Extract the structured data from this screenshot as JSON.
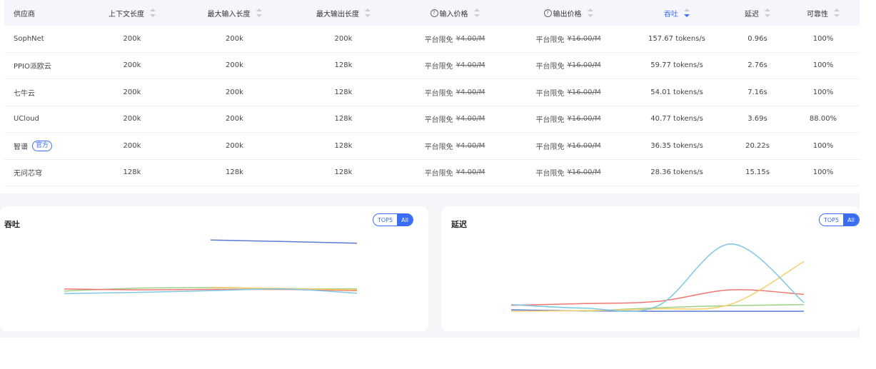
{
  "table": {
    "headers": [
      "供应商",
      "上下文长度",
      "最大输入长度",
      "最大输出长度",
      "输入价格",
      "输出价格",
      "吞吐",
      "延迟",
      "可靠性"
    ],
    "free_label": "平台限免",
    "official_badge": "官方",
    "rows": [
      {
        "provider": "SophNet",
        "context": "200k",
        "max_input": "200k",
        "max_output": "200k",
        "input_price": "¥4.00/M",
        "output_price": "¥16.00/M",
        "throughput": "157.67 tokens/s",
        "latency": "0.96s",
        "reliability": "100%"
      },
      {
        "provider": "PPIO派欧云",
        "context": "200k",
        "max_input": "200k",
        "max_output": "128k",
        "input_price": "¥4.00/M",
        "output_price": "¥16.00/M",
        "throughput": "59.77 tokens/s",
        "latency": "2.76s",
        "reliability": "100%"
      },
      {
        "provider": "七牛云",
        "context": "200k",
        "max_input": "200k",
        "max_output": "128k",
        "input_price": "¥4.00/M",
        "output_price": "¥16.00/M",
        "throughput": "54.01 tokens/s",
        "latency": "7.16s",
        "reliability": "100%"
      },
      {
        "provider": "UCloud",
        "context": "200k",
        "max_input": "200k",
        "max_output": "128k",
        "input_price": "¥4.00/M",
        "output_price": "¥16.00/M",
        "throughput": "40.77 tokens/s",
        "latency": "3.69s",
        "reliability": "88.00%"
      },
      {
        "provider": "智谱",
        "context": "200k",
        "max_input": "200k",
        "max_output": "128k",
        "input_price": "¥4.00/M",
        "output_price": "¥16.00/M",
        "throughput": "36.35 tokens/s",
        "latency": "20.22s",
        "reliability": "100%",
        "official": true
      },
      {
        "provider": "无问芯穹",
        "context": "128k",
        "max_input": "128k",
        "max_output": "128k",
        "input_price": "¥4.00/M",
        "output_price": "¥16.00/M",
        "throughput": "28.36 tokens/s",
        "latency": "15.15s",
        "reliability": "100%"
      }
    ]
  },
  "cards": {
    "throughput": {
      "title": "吞吐",
      "toggle_top": "TOP5",
      "toggle_all": "All"
    },
    "latency": {
      "title": "延迟",
      "toggle_top": "TOP5",
      "toggle_all": "All"
    }
  },
  "colors": {
    "accent": "#3b6cf5",
    "blue": "#5b7bd5",
    "green": "#9fd08a",
    "red": "#ee7770",
    "yellow": "#f7cf6c",
    "cyan": "#7ec8e3"
  },
  "chart_data": [
    {
      "type": "line",
      "title": "吞吐",
      "x": [
        0,
        1,
        2,
        3,
        4
      ],
      "series": [
        {
          "values": [
            null,
            null,
            157.7,
            154,
            150
          ],
          "color": "#5b7bd5"
        },
        {
          "values": [
            36,
            43,
            44,
            42,
            41
          ],
          "color": "#9fd08a"
        },
        {
          "values": [
            41,
            39,
            40,
            40,
            37
          ],
          "color": "#ee7770"
        },
        {
          "values": [
            null,
            null,
            45,
            42,
            39
          ],
          "color": "#f7cf6c"
        },
        {
          "values": [
            30,
            33,
            37,
            41,
            31
          ],
          "color": "#7ec8e3"
        }
      ],
      "ylim": [
        0,
        170
      ]
    },
    {
      "type": "line",
      "title": "延迟",
      "x": [
        0,
        1,
        2,
        3,
        4
      ],
      "series": [
        {
          "values": [
            1.4,
            1.1,
            1.0,
            1.0,
            1.0
          ],
          "color": "#5b7bd5"
        },
        {
          "values": [
            null,
            1.0,
            2.0,
            2.6,
            2.9
          ],
          "color": "#9fd08a"
        },
        {
          "values": [
            2.7,
            3.2,
            3.8,
            7.1,
            5.8
          ],
          "color": "#ee7770"
        },
        {
          "values": [
            1.0,
            1.2,
            1.7,
            3.0,
            15.2
          ],
          "color": "#f7cf6c"
        },
        {
          "values": [
            2.9,
            1.9,
            2.5,
            20.2,
            3.5
          ],
          "color": "#7ec8e3"
        }
      ],
      "ylim": [
        0,
        22
      ]
    }
  ]
}
